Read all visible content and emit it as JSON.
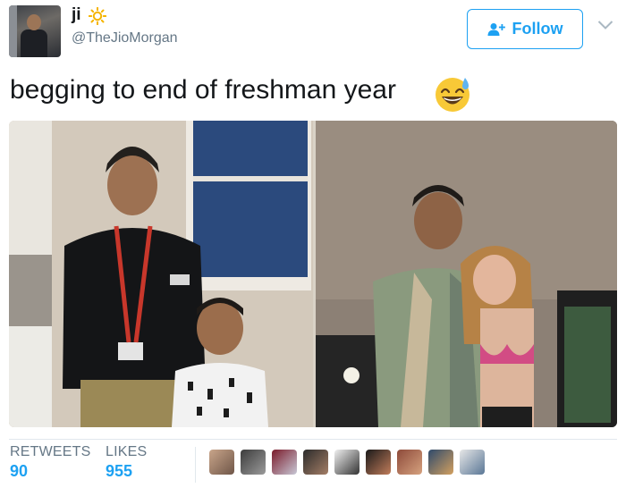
{
  "header": {
    "display_name": "ji",
    "name_emoji_icon": "sun-icon",
    "handle": "@TheJioMorgan"
  },
  "actions": {
    "follow_label": "Follow",
    "follow_icon": "add-user-icon",
    "menu_icon": "chevron-down-icon"
  },
  "tweet": {
    "text": "begging to end of freshman year",
    "trailing_emoji_icon": "grinning-sweat-emoji-icon"
  },
  "media": {
    "photos": [
      {
        "name": "photo-left",
        "description_icon": "photo"
      },
      {
        "name": "photo-right",
        "description_icon": "photo"
      }
    ]
  },
  "stats": {
    "retweets_label": "RETWEETS",
    "retweets_value": "90",
    "likes_label": "LIKES",
    "likes_value": "955",
    "liker_avatars_count": 9
  },
  "colors": {
    "accent": "#1da1f2",
    "text": "#14171a",
    "muted": "#657786",
    "border": "#e1e8ed"
  }
}
